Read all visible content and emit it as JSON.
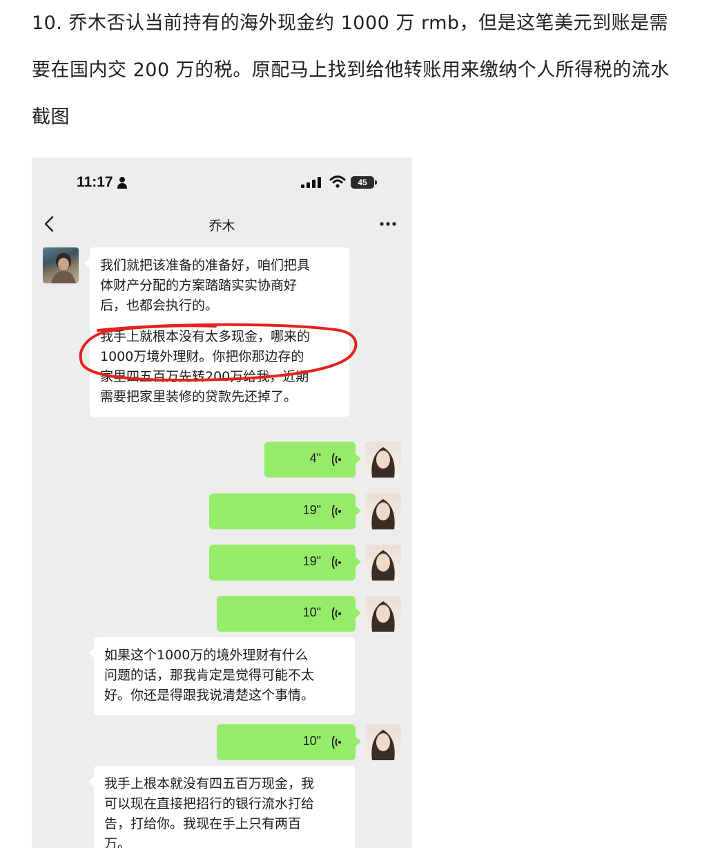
{
  "caption": {
    "line1": "10. 乔木否认当前持有的海外现金约 1000 万 rmb，但是这笔美元到账是需",
    "line2": "要在国内交 200 万的税。原配马上找到给他转账用来缴纳个人所得税的流水",
    "line3": "截图"
  },
  "status_bar": {
    "time": "11:17",
    "battery": "45"
  },
  "chat": {
    "title": "乔木",
    "messages": [
      {
        "type": "text",
        "paragraphs": [
          [
            "我们就把该准备的准备好，咱们把具",
            "体财产分配的方案踏踏实实协商好",
            "后，也都会执行的。"
          ],
          [
            "我手上就根本没有太多现金，哪来的",
            "1000万境外理财。你把你那边存的",
            "家里四五百万先转200万给我，近期",
            "需要把家里装修的贷款先还掉了。"
          ]
        ]
      },
      {
        "type": "voice",
        "duration": "4\""
      },
      {
        "type": "voice",
        "duration": "19\""
      },
      {
        "type": "voice",
        "duration": "19\""
      },
      {
        "type": "voice",
        "duration": "10\""
      },
      {
        "type": "text",
        "paragraphs": [
          [
            "如果这个1000万的境外理财有什么",
            "问题的话，那我肯定是觉得可能不太",
            "好。你还是得跟我说清楚这个事情。"
          ]
        ]
      },
      {
        "type": "voice",
        "duration": "10\""
      },
      {
        "type": "text",
        "paragraphs": [
          [
            "我手上根本就没有四五百万现金，我",
            "可以现在直接把招行的银行流水打给",
            "告，打给你。我现在手上只有两百",
            "万。"
          ]
        ]
      }
    ]
  },
  "colors": {
    "chat_background": "#ededed",
    "sent_bubble": "#95ec69",
    "received_bubble": "#ffffff",
    "annotation_ring": "#e3231b"
  }
}
